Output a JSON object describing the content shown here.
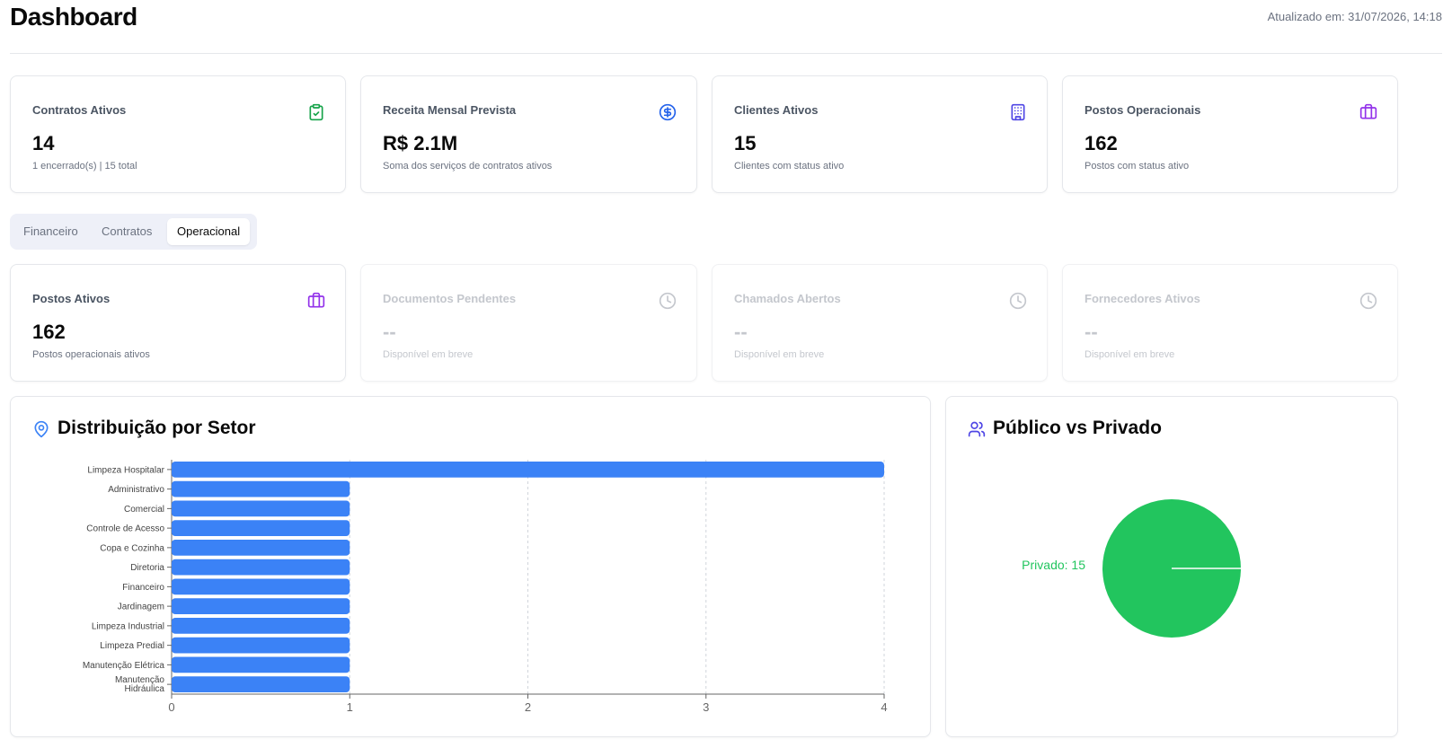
{
  "header": {
    "title": "Dashboard",
    "updated": "Atualizado em: 31/07/2026, 14:18"
  },
  "kpis_top": [
    {
      "title": "Contratos Ativos",
      "value": "14",
      "sub": "1 encerrado(s) | 15 total",
      "icon": "clipboard-check-icon",
      "color": "#16a34a"
    },
    {
      "title": "Receita Mensal Prevista",
      "value": "R$ 2.1M",
      "sub": "Soma dos serviços de contratos ativos",
      "icon": "dollar-circle-icon",
      "color": "#2563eb"
    },
    {
      "title": "Clientes Ativos",
      "value": "15",
      "sub": "Clientes com status ativo",
      "icon": "building-icon",
      "color": "#4f46e5"
    },
    {
      "title": "Postos Operacionais",
      "value": "162",
      "sub": "Postos com status ativo",
      "icon": "briefcase-icon",
      "color": "#9333ea"
    }
  ],
  "tabs": [
    {
      "label": "Financeiro",
      "active": false
    },
    {
      "label": "Contratos",
      "active": false
    },
    {
      "label": "Operacional",
      "active": true
    }
  ],
  "kpis_ops": [
    {
      "title": "Postos Ativos",
      "value": "162",
      "sub": "Postos operacionais ativos",
      "icon": "briefcase-icon",
      "color": "#9333ea"
    },
    {
      "title": "Documentos Pendentes",
      "value": "--",
      "sub": "Disponível em breve",
      "icon": "clock-icon",
      "color": "#c4c7cd"
    },
    {
      "title": "Chamados Abertos",
      "value": "--",
      "sub": "Disponível em breve",
      "icon": "clock-icon",
      "color": "#c4c7cd"
    },
    {
      "title": "Fornecedores Ativos",
      "value": "--",
      "sub": "Disponível em breve",
      "icon": "clock-icon",
      "color": "#c4c7cd"
    }
  ],
  "sector_panel": {
    "title": "Distribuição por Setor",
    "icon": "map-pin-icon",
    "accent": "#3b82f6"
  },
  "public_panel": {
    "title": "Público vs Privado",
    "icon": "users-icon",
    "accent": "#4f46e5"
  },
  "chart_data": [
    {
      "type": "bar",
      "orientation": "horizontal",
      "categories": [
        "Limpeza Hospitalar",
        "Administrativo",
        "Comercial",
        "Controle de Acesso",
        "Copa e Cozinha",
        "Diretoria",
        "Financeiro",
        "Jardinagem",
        "Limpeza Industrial",
        "Limpeza Predial",
        "Manutenção Elétrica",
        "Manutenção Hidráulica"
      ],
      "values": [
        4,
        1,
        1,
        1,
        1,
        1,
        1,
        1,
        1,
        1,
        1,
        1
      ],
      "xlim": [
        0,
        4
      ],
      "xticks": [
        "0",
        "1",
        "2",
        "3",
        "4"
      ],
      "grid": "vertical dashed",
      "color": "#3b82f6"
    },
    {
      "type": "pie",
      "slices": [
        {
          "label": "Privado",
          "value": 15,
          "color": "#22c55e"
        }
      ],
      "label_text": "Privado: 15"
    }
  ]
}
